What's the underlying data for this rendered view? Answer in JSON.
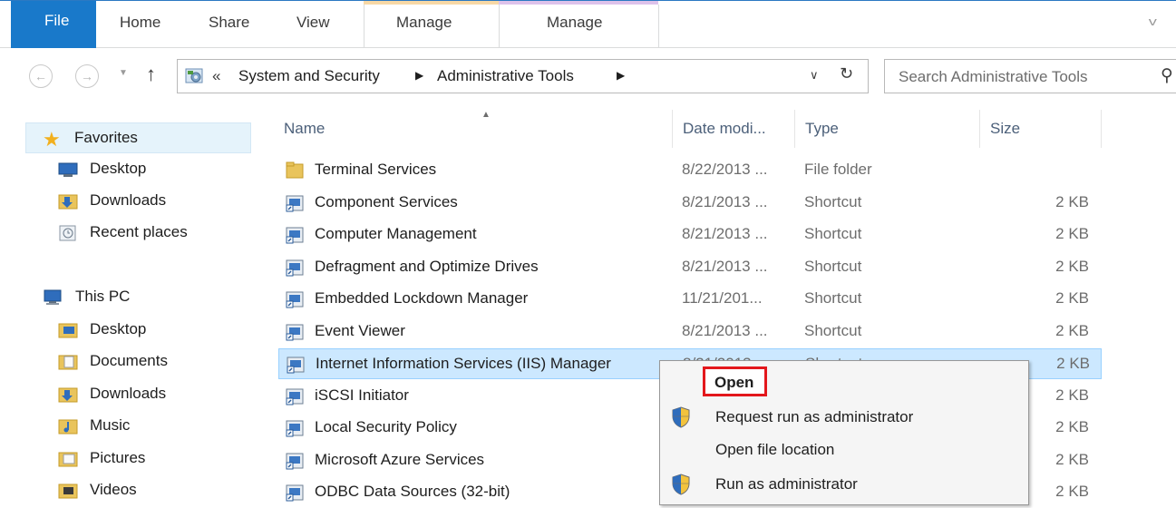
{
  "ribbon": {
    "tabs": [
      "File",
      "Home",
      "Share",
      "View",
      "Manage",
      "Manage"
    ]
  },
  "address": {
    "overflow": "«",
    "crumbs": [
      "System and Security",
      "Administrative Tools"
    ],
    "search_placeholder": "Search Administrative Tools"
  },
  "nav": {
    "favorites": "Favorites",
    "fav_items": [
      "Desktop",
      "Downloads",
      "Recent places"
    ],
    "this_pc": "This PC",
    "pc_items": [
      "Desktop",
      "Documents",
      "Downloads",
      "Music",
      "Pictures",
      "Videos"
    ]
  },
  "columns": {
    "name": "Name",
    "date": "Date modi...",
    "type": "Type",
    "size": "Size"
  },
  "files": [
    {
      "name": "Terminal Services",
      "date": "8/22/2013 ...",
      "type": "File folder",
      "size": "",
      "icon": "folder-icon"
    },
    {
      "name": "Component Services",
      "date": "8/21/2013 ...",
      "type": "Shortcut",
      "size": "2 KB",
      "icon": "component-services-icon"
    },
    {
      "name": "Computer Management",
      "date": "8/21/2013 ...",
      "type": "Shortcut",
      "size": "2 KB",
      "icon": "computer-management-icon"
    },
    {
      "name": "Defragment and Optimize Drives",
      "date": "8/21/2013 ...",
      "type": "Shortcut",
      "size": "2 KB",
      "icon": "defragment-icon"
    },
    {
      "name": "Embedded Lockdown Manager",
      "date": "11/21/201...",
      "type": "Shortcut",
      "size": "2 KB",
      "icon": "lockdown-icon"
    },
    {
      "name": "Event Viewer",
      "date": "8/21/2013 ...",
      "type": "Shortcut",
      "size": "2 KB",
      "icon": "event-viewer-icon"
    },
    {
      "name": "Internet Information Services (IIS) Manager",
      "date": "8/21/2013 ...",
      "type": "Shortcut",
      "size": "2 KB",
      "icon": "iis-icon"
    },
    {
      "name": "iSCSI Initiator",
      "date": "",
      "type": "",
      "size": "2 KB",
      "icon": "iscsi-icon"
    },
    {
      "name": "Local Security Policy",
      "date": "",
      "type": "",
      "size": "2 KB",
      "icon": "security-policy-icon"
    },
    {
      "name": "Microsoft Azure Services",
      "date": "",
      "type": "",
      "size": "2 KB",
      "icon": "azure-icon"
    },
    {
      "name": "ODBC Data Sources (32-bit)",
      "date": "",
      "type": "",
      "size": "2 KB",
      "icon": "odbc-icon"
    }
  ],
  "context_menu": {
    "open": "Open",
    "request_admin": "Request run as administrator",
    "open_location": "Open file location",
    "run_admin": "Run as administrator"
  },
  "colors": {
    "file_tab": "#1979ca",
    "selection": "#cce8ff",
    "highlight_box": "#e3171c"
  }
}
